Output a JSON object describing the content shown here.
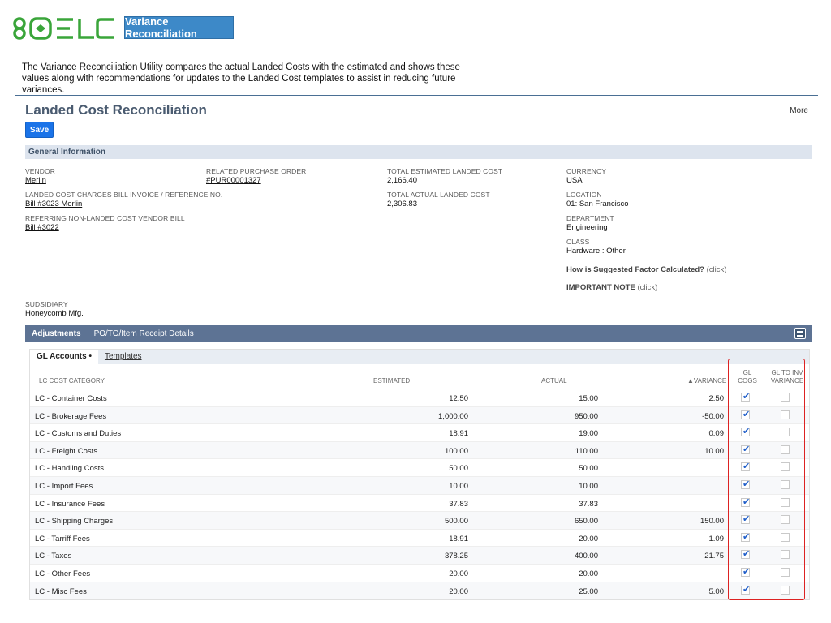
{
  "brand": {
    "logo_text": "8QELC",
    "title": "Variance Reconciliation"
  },
  "intro": "The Variance Reconciliation Utility compares the actual Landed Costs with the estimated and shows these values along with recommendations for updates to the Landed Cost templates to assist in reducing future variances.",
  "header": {
    "title": "Landed Cost Reconciliation",
    "more": "More",
    "save": "Save"
  },
  "general": {
    "section": "General Information",
    "vendor_label": "VENDOR",
    "vendor": "Merlin",
    "bill_ref_label": "LANDED COST CHARGES BILL INVOICE / REFERENCE NO.",
    "bill_ref": "Bill #3023 Merlin",
    "nonlc_label": "REFERRING NON-LANDED COST VENDOR BILL",
    "nonlc": "Bill #3022",
    "po_label": "RELATED PURCHASE ORDER",
    "po": "#PUR00001327",
    "est_label": "TOTAL ESTIMATED LANDED COST",
    "est": "2,166.40",
    "act_label": "TOTAL ACTUAL LANDED COST",
    "act": "2,306.83",
    "currency_label": "CURRENCY",
    "currency": "USA",
    "location_label": "LOCATION",
    "location": "01: San Francisco",
    "department_label": "DEPARTMENT",
    "department": "Engineering",
    "class_label": "CLASS",
    "class": "Hardware : Other",
    "factor_q": "How is Suggested Factor Calculated?",
    "factor_click": "(click)",
    "note_q": "IMPORTANT NOTE",
    "note_click": "(click)",
    "subsidiary_label": "SUDSIDIARY",
    "subsidiary": "Honeycomb Mfg."
  },
  "subtabs": {
    "adjustments": "Adjustments",
    "po_details": "PO/TO/Item Receipt Details"
  },
  "inner_tabs": {
    "gl_accounts": "GL Accounts •",
    "templates": "Templates"
  },
  "columns": {
    "category": "LC COST CATEGORY",
    "estimated": "ESTIMATED",
    "actual": "ACTUAL",
    "variance": "▲VARIANCE",
    "gl_cogs_1": "GL",
    "gl_cogs_2": "COGS",
    "gl_inv_1": "GL TO INV",
    "gl_inv_2": "VARIANCE"
  },
  "rows": [
    {
      "category": "LC - Container Costs",
      "estimated": "12.50",
      "actual": "15.00",
      "variance": "2.50",
      "cogs": true,
      "inv": false
    },
    {
      "category": "LC - Brokerage Fees",
      "estimated": "1,000.00",
      "actual": "950.00",
      "variance": "-50.00",
      "cogs": true,
      "inv": false
    },
    {
      "category": "LC - Customs and Duties",
      "estimated": "18.91",
      "actual": "19.00",
      "variance": "0.09",
      "cogs": true,
      "inv": false
    },
    {
      "category": "LC - Freight Costs",
      "estimated": "100.00",
      "actual": "110.00",
      "variance": "10.00",
      "cogs": true,
      "inv": false
    },
    {
      "category": "LC - Handling Costs",
      "estimated": "50.00",
      "actual": "50.00",
      "variance": "",
      "cogs": true,
      "inv": false
    },
    {
      "category": "LC - Import Fees",
      "estimated": "10.00",
      "actual": "10.00",
      "variance": "",
      "cogs": true,
      "inv": false
    },
    {
      "category": "LC - Insurance Fees",
      "estimated": "37.83",
      "actual": "37.83",
      "variance": "",
      "cogs": true,
      "inv": false
    },
    {
      "category": "LC - Shipping Charges",
      "estimated": "500.00",
      "actual": "650.00",
      "variance": "150.00",
      "cogs": true,
      "inv": false
    },
    {
      "category": "LC - Tarriff Fees",
      "estimated": "18.91",
      "actual": "20.00",
      "variance": "1.09",
      "cogs": true,
      "inv": false
    },
    {
      "category": "LC - Taxes",
      "estimated": "378.25",
      "actual": "400.00",
      "variance": "21.75",
      "cogs": true,
      "inv": false
    },
    {
      "category": "LC - Other Fees",
      "estimated": "20.00",
      "actual": "20.00",
      "variance": "",
      "cogs": true,
      "inv": false
    },
    {
      "category": "LC - Misc Fees",
      "estimated": "20.00",
      "actual": "25.00",
      "variance": "5.00",
      "cogs": true,
      "inv": false
    }
  ],
  "colors": {
    "accent": "#1a73e8",
    "badge": "#3d89c8",
    "subtab_bar": "#5d7394",
    "highlight": "#dd2222"
  },
  "icons": {
    "subtab_toggle": "collapse-icon",
    "checkbox_on": "checkmark-icon"
  }
}
